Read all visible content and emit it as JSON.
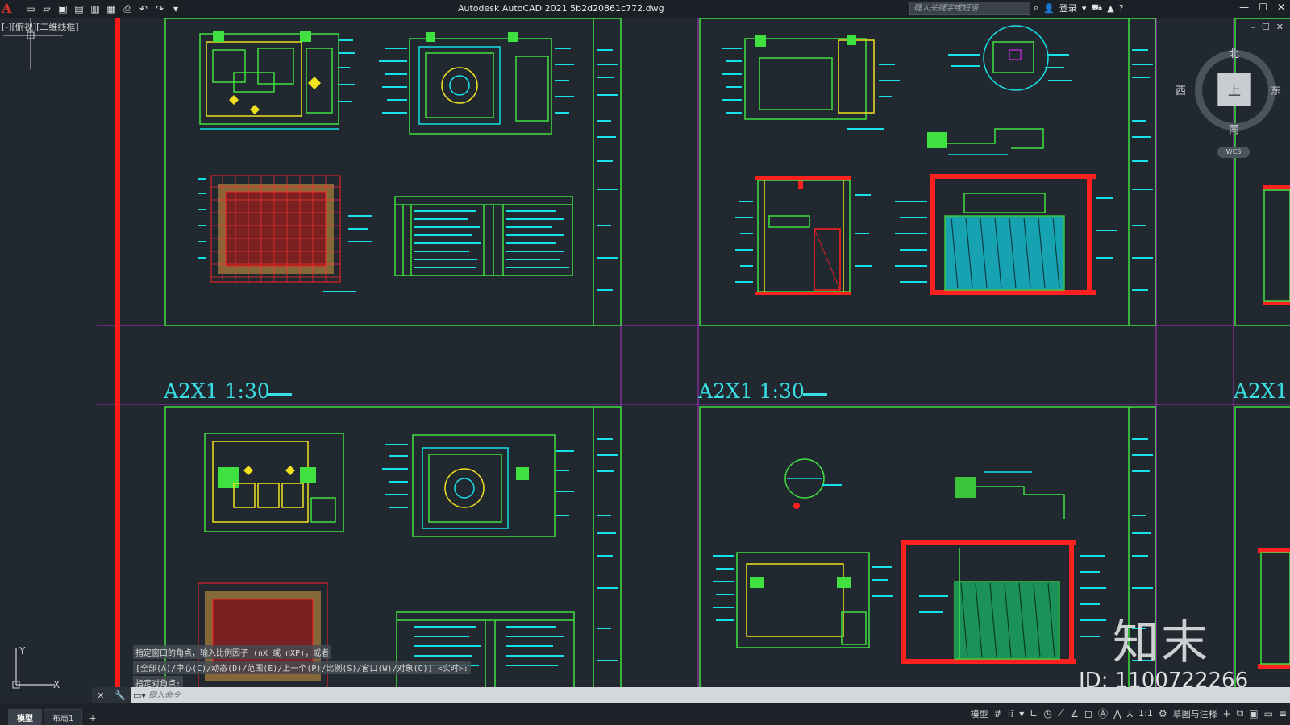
{
  "app": {
    "title": "Autodesk AutoCAD 2021    5b2d20861c772.dwg",
    "logo": "A"
  },
  "quick_access": [
    {
      "name": "new-icon",
      "glyph": "▭"
    },
    {
      "name": "open-icon",
      "glyph": "▱"
    },
    {
      "name": "save-icon",
      "glyph": "▣"
    },
    {
      "name": "save-as-icon",
      "glyph": "▤"
    },
    {
      "name": "publish-icon",
      "glyph": "▥"
    },
    {
      "name": "plot-preview-icon",
      "glyph": "▦"
    },
    {
      "name": "print-icon",
      "glyph": "⎙"
    },
    {
      "name": "undo-icon",
      "glyph": "↶"
    },
    {
      "name": "redo-icon",
      "glyph": "↷"
    },
    {
      "name": "workspace-dropdown-icon",
      "glyph": "▾"
    }
  ],
  "search": {
    "placeholder": "键入关键字或短语"
  },
  "user": {
    "login_label": "登录"
  },
  "viewport": {
    "label": "[-][俯视][二维线框]"
  },
  "viewcube": {
    "top_label": "上",
    "north": "北",
    "south": "南",
    "west": "西",
    "east": "东",
    "wcs": "WCS"
  },
  "sheets": {
    "label_left": "A2X1 1:30",
    "label_mid": "A2X1 1:30",
    "label_right": "A2X1"
  },
  "command": {
    "history": [
      "指定窗口的角点，输入比例因子 (nX 或 nXP)，或者",
      "[全部(A)/中心(C)/动态(D)/范围(E)/上一个(P)/比例(S)/窗口(W)/对象(O)] <实时>:",
      "指定对角点:"
    ],
    "placeholder": "键入命令"
  },
  "ucs": {
    "x": "X",
    "y": "Y"
  },
  "status": {
    "tabs": [
      {
        "label": "模型",
        "active": true
      },
      {
        "label": "布局1",
        "active": false
      }
    ],
    "add_tab": "+",
    "model_label": "模型",
    "scale": "1:1",
    "workspace": "草图与注释"
  },
  "watermark": {
    "brand": "知末",
    "id": "ID: 1100722266"
  },
  "colors": {
    "background": "#212830",
    "green": "#3fe03f",
    "cyan": "#16e0e8",
    "red": "#ff2020",
    "magenta": "#b02cc8",
    "yellow": "#f0e020"
  }
}
